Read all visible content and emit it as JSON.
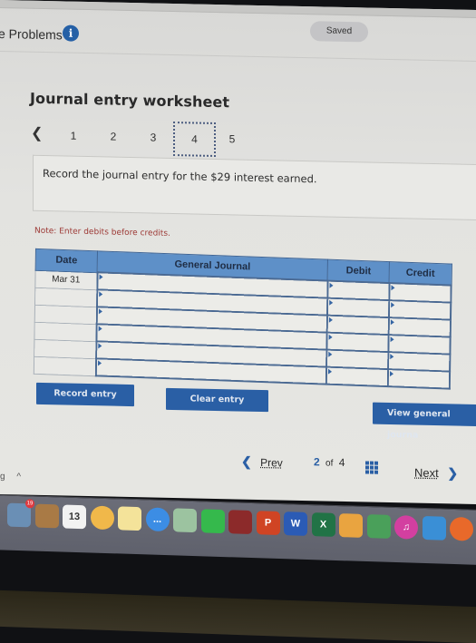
{
  "header": {
    "problems_label": "e Problems",
    "info_icon": "info-icon",
    "saved_label": "Saved"
  },
  "worksheet": {
    "title": "Journal entry worksheet",
    "pager": {
      "prev_icon": "chevron-left-icon",
      "pages": [
        "1",
        "2",
        "3",
        "4",
        "5"
      ],
      "active_page": "4"
    },
    "prompt": "Record the journal entry for the $29 interest earned.",
    "note": "Note: Enter debits before credits."
  },
  "journal_table": {
    "columns": [
      "Date",
      "General Journal",
      "Debit",
      "Credit"
    ],
    "rows": [
      {
        "date": "Mar 31",
        "account": "",
        "debit": "",
        "credit": ""
      },
      {
        "date": "",
        "account": "",
        "debit": "",
        "credit": ""
      },
      {
        "date": "",
        "account": "",
        "debit": "",
        "credit": ""
      },
      {
        "date": "",
        "account": "",
        "debit": "",
        "credit": ""
      },
      {
        "date": "",
        "account": "",
        "debit": "",
        "credit": ""
      },
      {
        "date": "",
        "account": "",
        "debit": "",
        "credit": ""
      }
    ]
  },
  "buttons": {
    "record_entry": "Record entry",
    "clear_entry": "Clear entry",
    "view_general_journal": "View general journa"
  },
  "navigation": {
    "prev_label": "Prev",
    "current": "2",
    "of_label": "of",
    "total": "4",
    "grid_icon": "grid-icon",
    "next_label": "Next"
  },
  "browser": {
    "partial_text": "g",
    "caret": "^"
  },
  "dock": {
    "items": [
      {
        "name": "mail",
        "label": "",
        "badge": "19",
        "color": "#6a8fb5"
      },
      {
        "name": "contacts",
        "label": "",
        "color": "#a97a45"
      },
      {
        "name": "calendar",
        "label": "13",
        "color": "#f2f2f2"
      },
      {
        "name": "photos",
        "label": "",
        "color": "#f0b84a"
      },
      {
        "name": "notes",
        "label": "",
        "color": "#f4e39a"
      },
      {
        "name": "messages",
        "label": "...",
        "color": "#3c8de4"
      },
      {
        "name": "maps",
        "label": "",
        "color": "#9cc3a0"
      },
      {
        "name": "facetime",
        "label": "",
        "color": "#35b94c"
      },
      {
        "name": "photo-booth",
        "label": "",
        "color": "#8c2a2a"
      },
      {
        "name": "powerpoint",
        "label": "P",
        "color": "#d04424"
      },
      {
        "name": "word",
        "label": "W",
        "color": "#2b5bb5"
      },
      {
        "name": "excel",
        "label": "X",
        "color": "#217346"
      },
      {
        "name": "pages",
        "label": "",
        "color": "#e9a440"
      },
      {
        "name": "numbers",
        "label": "",
        "color": "#4aa05a"
      },
      {
        "name": "itunes",
        "label": "♫",
        "color": "#d33fa0"
      },
      {
        "name": "keynote",
        "label": "",
        "color": "#3a8fd6"
      },
      {
        "name": "ibooks",
        "label": "",
        "color": "#e8692a"
      }
    ]
  }
}
